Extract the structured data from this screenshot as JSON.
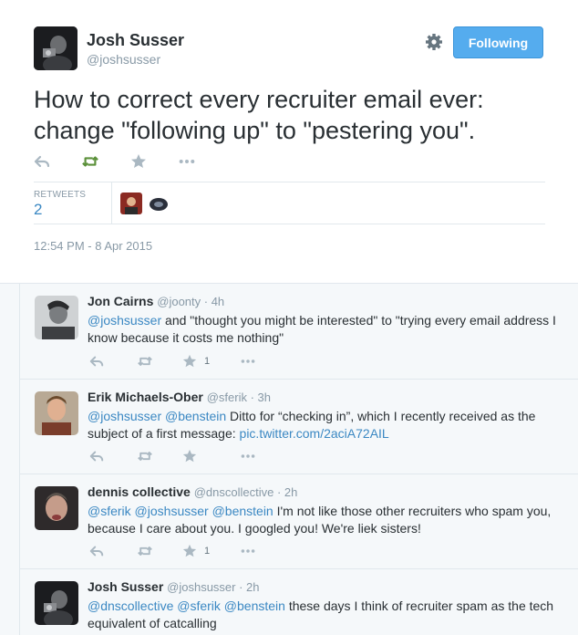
{
  "main_tweet": {
    "name": "Josh Susser",
    "handle": "@joshsusser",
    "follow_label": "Following",
    "text": "How to correct every recruiter email ever: change \"following up\" to \"pestering you\".",
    "retweets_label": "RETWEETS",
    "retweets_count": "2",
    "timestamp": "12:54 PM - 8 Apr 2015",
    "icons": [
      "reply-icon",
      "retweet-icon",
      "favorite-icon",
      "more-icon",
      "gear-icon"
    ],
    "retweeted_color": "#5c913b"
  },
  "replies": [
    {
      "name": "Jon Cairns",
      "meta": "@joonty · 4h",
      "mention": "@joshsusser",
      "text": " and \"thought you might be interested\" to \"trying every email address I know because it costs me nothing\"",
      "favorites": "1"
    },
    {
      "name": "Erik Michaels-Ober",
      "meta": "@sferik · 3h",
      "mention": "@joshsusser @benstein",
      "text": " Ditto for “checking in”, which I recently received as the subject of a first message: ",
      "link": "pic.twitter.com/2aciA72AIL",
      "favorites": ""
    },
    {
      "name": "dennis collective",
      "meta": "@dnscollective · 2h",
      "mention": "@sferik @joshsusser @benstein",
      "text": " I'm not like those other recruiters who spam you, because I care about you. I googled you! We're liek sisters!",
      "favorites": "1"
    },
    {
      "name": "Josh Susser",
      "meta": "@joshsusser · 2h",
      "mention": "@dnscollective @sferik @benstein",
      "text": " these days I think of recruiter spam as the tech equivalent of catcalling",
      "favorites": ""
    }
  ],
  "colors": {
    "link": "#3b88c3",
    "follow_button": "#55acee",
    "muted": "#8899a6",
    "reply_bg": "#f5f8fa"
  }
}
